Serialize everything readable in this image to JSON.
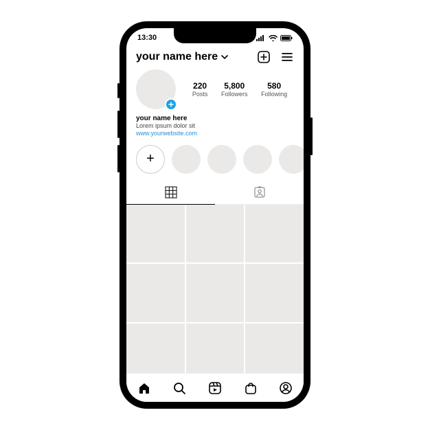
{
  "status": {
    "time": "13:30"
  },
  "header": {
    "username": "your name here"
  },
  "profile": {
    "stats": {
      "posts": {
        "value": "220",
        "label": "Posts"
      },
      "followers": {
        "value": "5,800",
        "label": "Followers"
      },
      "following": {
        "value": "580",
        "label": "Following"
      }
    },
    "bio": {
      "name": "your name here",
      "text": "Lorem ipsum dolor sit",
      "link": "www.yourwebsite.com"
    }
  },
  "highlights": {
    "new_label": "+"
  }
}
